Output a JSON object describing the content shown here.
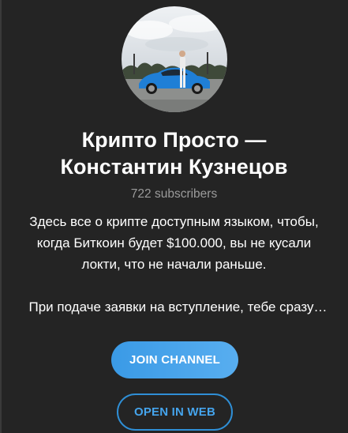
{
  "channel": {
    "title_line1": "Крипто Просто —",
    "title_line2": "Константин Кузнецов",
    "subscribers": "722 subscribers",
    "description": {
      "line1": "Здесь все о крипте доступным языком, чтобы,",
      "line2": "когда Биткоин будет $100.000, вы не кусали",
      "line3": "локти, что не начали раньше.",
      "line4": "При подаче заявки на вступление, тебе сразу…"
    }
  },
  "buttons": {
    "join_label": "JOIN CHANNEL",
    "web_label": "OPEN IN WEB"
  },
  "colors": {
    "background": "#242424",
    "accent": "#3a9ae6",
    "muted_text": "#9b9b9b"
  }
}
